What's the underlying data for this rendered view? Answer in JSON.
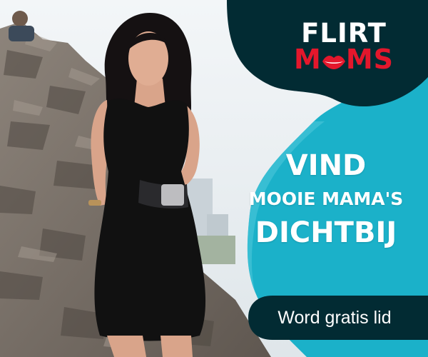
{
  "logo": {
    "line1": "FLIRT",
    "line2_pre": "M",
    "line2_post": "MS"
  },
  "headline": {
    "line1": "VIND",
    "line2": "MOOIE MAMA'S",
    "line3": "DICHTBIJ"
  },
  "cta": {
    "label": "Word gratis lid"
  },
  "colors": {
    "dark_panel": "#022b33",
    "teal_panel": "#1bb1c9",
    "logo_red": "#e3172c",
    "dress": "#111111",
    "rock": "#7a7068"
  }
}
